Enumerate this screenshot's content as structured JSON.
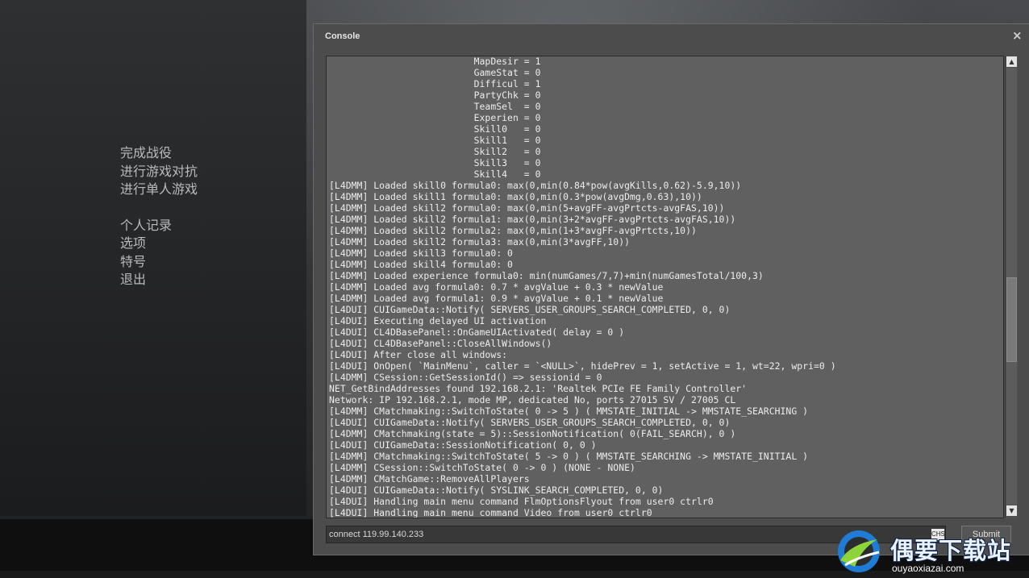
{
  "main_menu": {
    "group1": [
      "完成战役",
      "进行游戏对抗",
      "进行单人游戏"
    ],
    "group2": [
      "个人记录",
      "选项",
      "特号",
      "退出"
    ]
  },
  "console": {
    "title": "Console",
    "close_glyph": "×",
    "output_lines": [
      "                          MapDesir = 1",
      "                          GameStat = 0",
      "                          Difficul = 1",
      "                          PartyChk = 0",
      "                          TeamSel  = 0",
      "                          Experien = 0",
      "                          Skill0   = 0",
      "                          Skill1   = 0",
      "                          Skill2   = 0",
      "                          Skill3   = 0",
      "                          Skill4   = 0",
      "[L4DMM] Loaded skill0 formula0: max(0,min(0.84*pow(avgKills,0.62)-5.9,10))",
      "[L4DMM] Loaded skill1 formula0: max(0,min(0.3*pow(avgDmg,0.63),10))",
      "[L4DMM] Loaded skill2 formula0: max(0,min(5+avgFF-avgPrtcts-avgFAS,10))",
      "[L4DMM] Loaded skill2 formula1: max(0,min(3+2*avgFF-avgPrtcts-avgFAS,10))",
      "[L4DMM] Loaded skill2 formula2: max(0,min(1+3*avgFF-avgPrtcts,10))",
      "[L4DMM] Loaded skill2 formula3: max(0,min(3*avgFF,10))",
      "[L4DMM] Loaded skill3 formula0: 0",
      "[L4DMM] Loaded skill4 formula0: 0",
      "[L4DMM] Loaded experience formula0: min(numGames/7,7)+min(numGamesTotal/100,3)",
      "[L4DMM] Loaded avg formula0: 0.7 * avgValue + 0.3 * newValue",
      "[L4DMM] Loaded avg formula1: 0.9 * avgValue + 0.1 * newValue",
      "[L4DUI] CUIGameData::Notify( SERVERS_USER_GROUPS_SEARCH_COMPLETED, 0, 0)",
      "[L4DUI] Executing delayed UI activation",
      "[L4DUI] CL4DBasePanel::OnGameUIActivated( delay = 0 )",
      "[L4DUI] CL4DBasePanel::CloseAllWindows()",
      "[L4DUI] After close all windows:",
      "[L4DUI] OnOpen( `MainMenu`, caller = `<NULL>`, hidePrev = 1, setActive = 1, wt=22, wpri=0 )",
      "[L4DMM] CSession::GetSessionId() => sessionid = 0",
      "NET_GetBindAddresses found 192.168.2.1: 'Realtek PCIe FE Family Controller'",
      "Network: IP 192.168.2.1, mode MP, dedicated No, ports 27015 SV / 27005 CL",
      "[L4DMM] CMatchmaking::SwitchToState( 0 -> 5 ) ( MMSTATE_INITIAL -> MMSTATE_SEARCHING )",
      "[L4DUI] CUIGameData::Notify( SERVERS_USER_GROUPS_SEARCH_COMPLETED, 0, 0)",
      "[L4DMM] CMatchmaking(state = 5)::SessionNotification( 0(FAIL_SEARCH), 0 )",
      "[L4DUI] CUIGameData::SessionNotification( 0, 0 )",
      "[L4DMM] CMatchmaking::SwitchToState( 5 -> 0 ) ( MMSTATE_SEARCHING -> MMSTATE_INITIAL )",
      "[L4DMM] CSession::SwitchToState( 0 -> 0 ) (NONE - NONE)",
      "[L4DMM] CMatchGame::RemoveAllPlayers",
      "[L4DUI] CUIGameData::Notify( SYSLINK_SEARCH_COMPLETED, 0, 0)",
      "[L4DUI] Handling main menu command FlmOptionsFlyout from user0 ctrlr0",
      "[L4DUI] Handling main menu command Video from user0 ctrlr0"
    ],
    "input_value": "connect 119.99.140.233",
    "ime_indicator": "CHS",
    "submit_label": "Submit",
    "scroll_up_glyph": "▲",
    "scroll_down_glyph": "▼"
  },
  "watermark": {
    "name": "偶要下载站",
    "url": "ouyaoxiazai.com"
  },
  "colors": {
    "console_bg": "#4c4c4c",
    "output_bg": "#606060",
    "output_text": "#ededed",
    "menu_text": "#b9babb"
  }
}
